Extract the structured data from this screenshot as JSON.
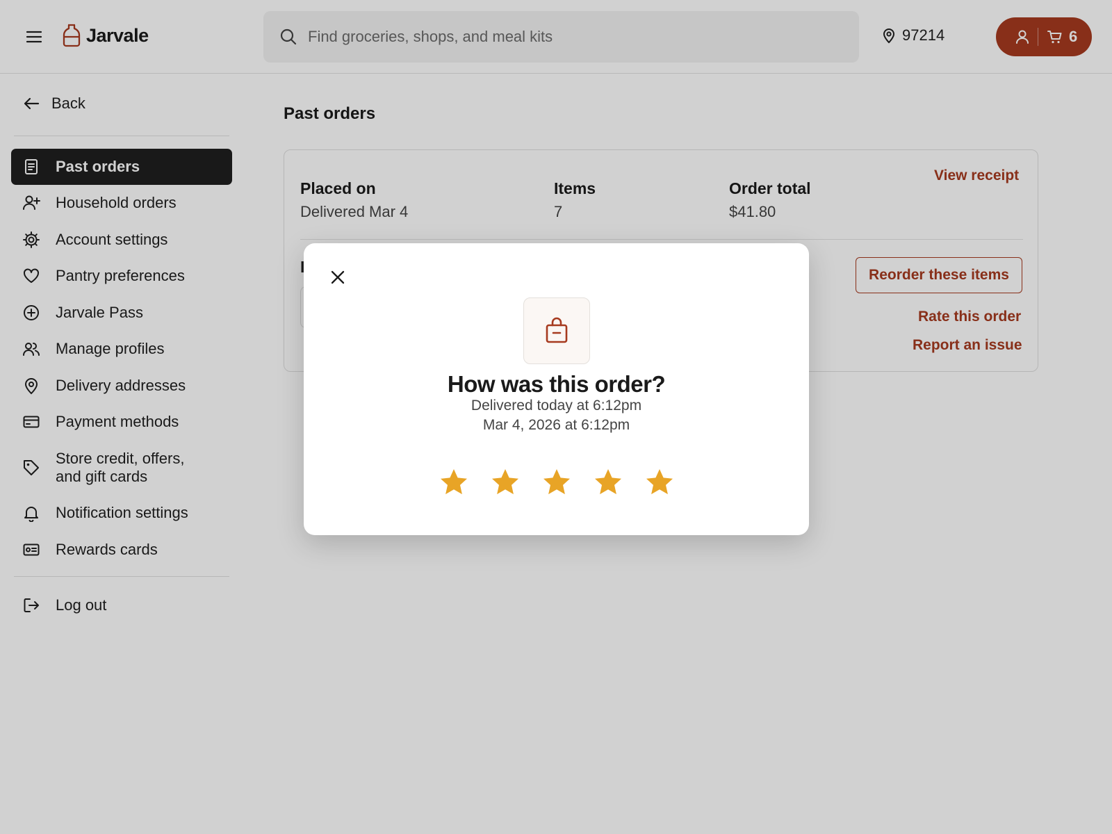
{
  "header": {
    "brand": "Jarvale",
    "search_placeholder": "Find groceries, shops, and meal kits",
    "zip": "97214",
    "cart_count": "6"
  },
  "sidebar": {
    "back_label": "Back",
    "items": [
      {
        "label": "Past orders",
        "icon": "receipt-icon",
        "active": true
      },
      {
        "label": "Household orders",
        "icon": "user-plus-icon"
      },
      {
        "label": "Account settings",
        "icon": "gear-icon"
      },
      {
        "label": "Pantry preferences",
        "icon": "heart-icon"
      },
      {
        "label": "Jarvale Pass",
        "icon": "plus-circle-icon"
      },
      {
        "label": "Manage profiles",
        "icon": "users-icon"
      },
      {
        "label": "Delivery addresses",
        "icon": "map-pin-icon"
      },
      {
        "label": "Payment methods",
        "icon": "credit-card-icon"
      },
      {
        "label": "Store credit, offers,",
        "label2": "and gift cards",
        "icon": "tag-icon"
      },
      {
        "label": "Notification settings",
        "icon": "bell-icon"
      },
      {
        "label": "Rewards cards",
        "icon": "id-card-icon"
      }
    ],
    "logout_label": "Log out"
  },
  "main": {
    "title": "Past orders",
    "order": {
      "placed_label": "Placed on",
      "placed_value": "Delivered Mar 4",
      "items_label": "Items",
      "items_value": "7",
      "total_label": "Order total",
      "total_value": "$41.80",
      "view_receipt": "View receipt",
      "reorder": "Reorder these items",
      "rate": "Rate this order",
      "report": "Report an issue",
      "section_initial": "I"
    }
  },
  "modal": {
    "title": "How was this order?",
    "delivered_line": "Delivered today at 6:12pm",
    "date_line": "Mar 4, 2026 at 6:12pm",
    "rating_max": 5,
    "colors": {
      "accent": "#a63a1f",
      "star": "#e8a426"
    }
  }
}
